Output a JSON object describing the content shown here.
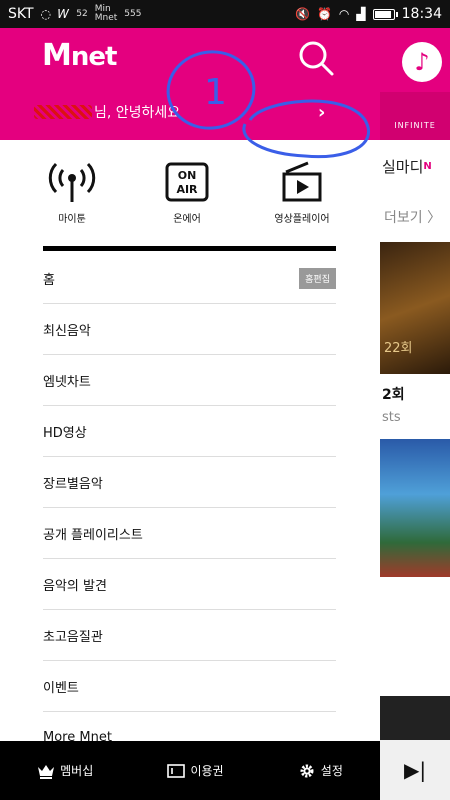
{
  "status_bar": {
    "carrier": "SKT",
    "left_icons": [
      "circle-icon",
      "w-icon",
      "52-icon",
      "notification-icon",
      "message-icon"
    ],
    "left_tiny_a": "52",
    "left_tiny_b": "Min\nMnet",
    "left_tiny_c": "555",
    "time": "18:34",
    "battery_level": 0.95
  },
  "drawer": {
    "logo_text_m": "M",
    "logo_text_net": "net",
    "greeting": "님, 안녕하세요",
    "greeting_arrow": "›",
    "quick_links": [
      {
        "icon": "antenna-icon",
        "label": "마이툰"
      },
      {
        "icon": "on-air-icon",
        "label": "온에어"
      },
      {
        "icon": "video-player-icon",
        "label": "영상플레이어"
      }
    ],
    "on_air_line1": "ON",
    "on_air_line2": "AIR",
    "menu": [
      {
        "label": "홈",
        "badge": "홈편집"
      },
      {
        "label": "최신음악"
      },
      {
        "label": "엠넷차트"
      },
      {
        "label": "HD영상"
      },
      {
        "label": "장르별음악"
      },
      {
        "label": "공개 플레이리스트"
      },
      {
        "label": "음악의 발견"
      },
      {
        "label": "초고음질관"
      },
      {
        "label": "이벤트"
      },
      {
        "label": "More Mnet"
      }
    ],
    "bottom_bar": [
      {
        "icon": "crown-icon",
        "label": "멤버십"
      },
      {
        "icon": "ticket-icon",
        "label": "이용권"
      },
      {
        "icon": "gear-icon",
        "label": "설정"
      }
    ]
  },
  "background_app": {
    "header_badge": "INFINITE",
    "row_text": "실마디",
    "row_sup": "N",
    "more_label": "더보기 〉",
    "thumb1_text": "22회",
    "text1": "2회",
    "text2": "sts",
    "next_button_glyph": "▶|"
  },
  "annotation": {
    "number": "1",
    "color": "#3a5ee8"
  },
  "colors": {
    "brand": "#e4007f",
    "menu_text": "#111111",
    "bottom_bar": "#000000"
  }
}
